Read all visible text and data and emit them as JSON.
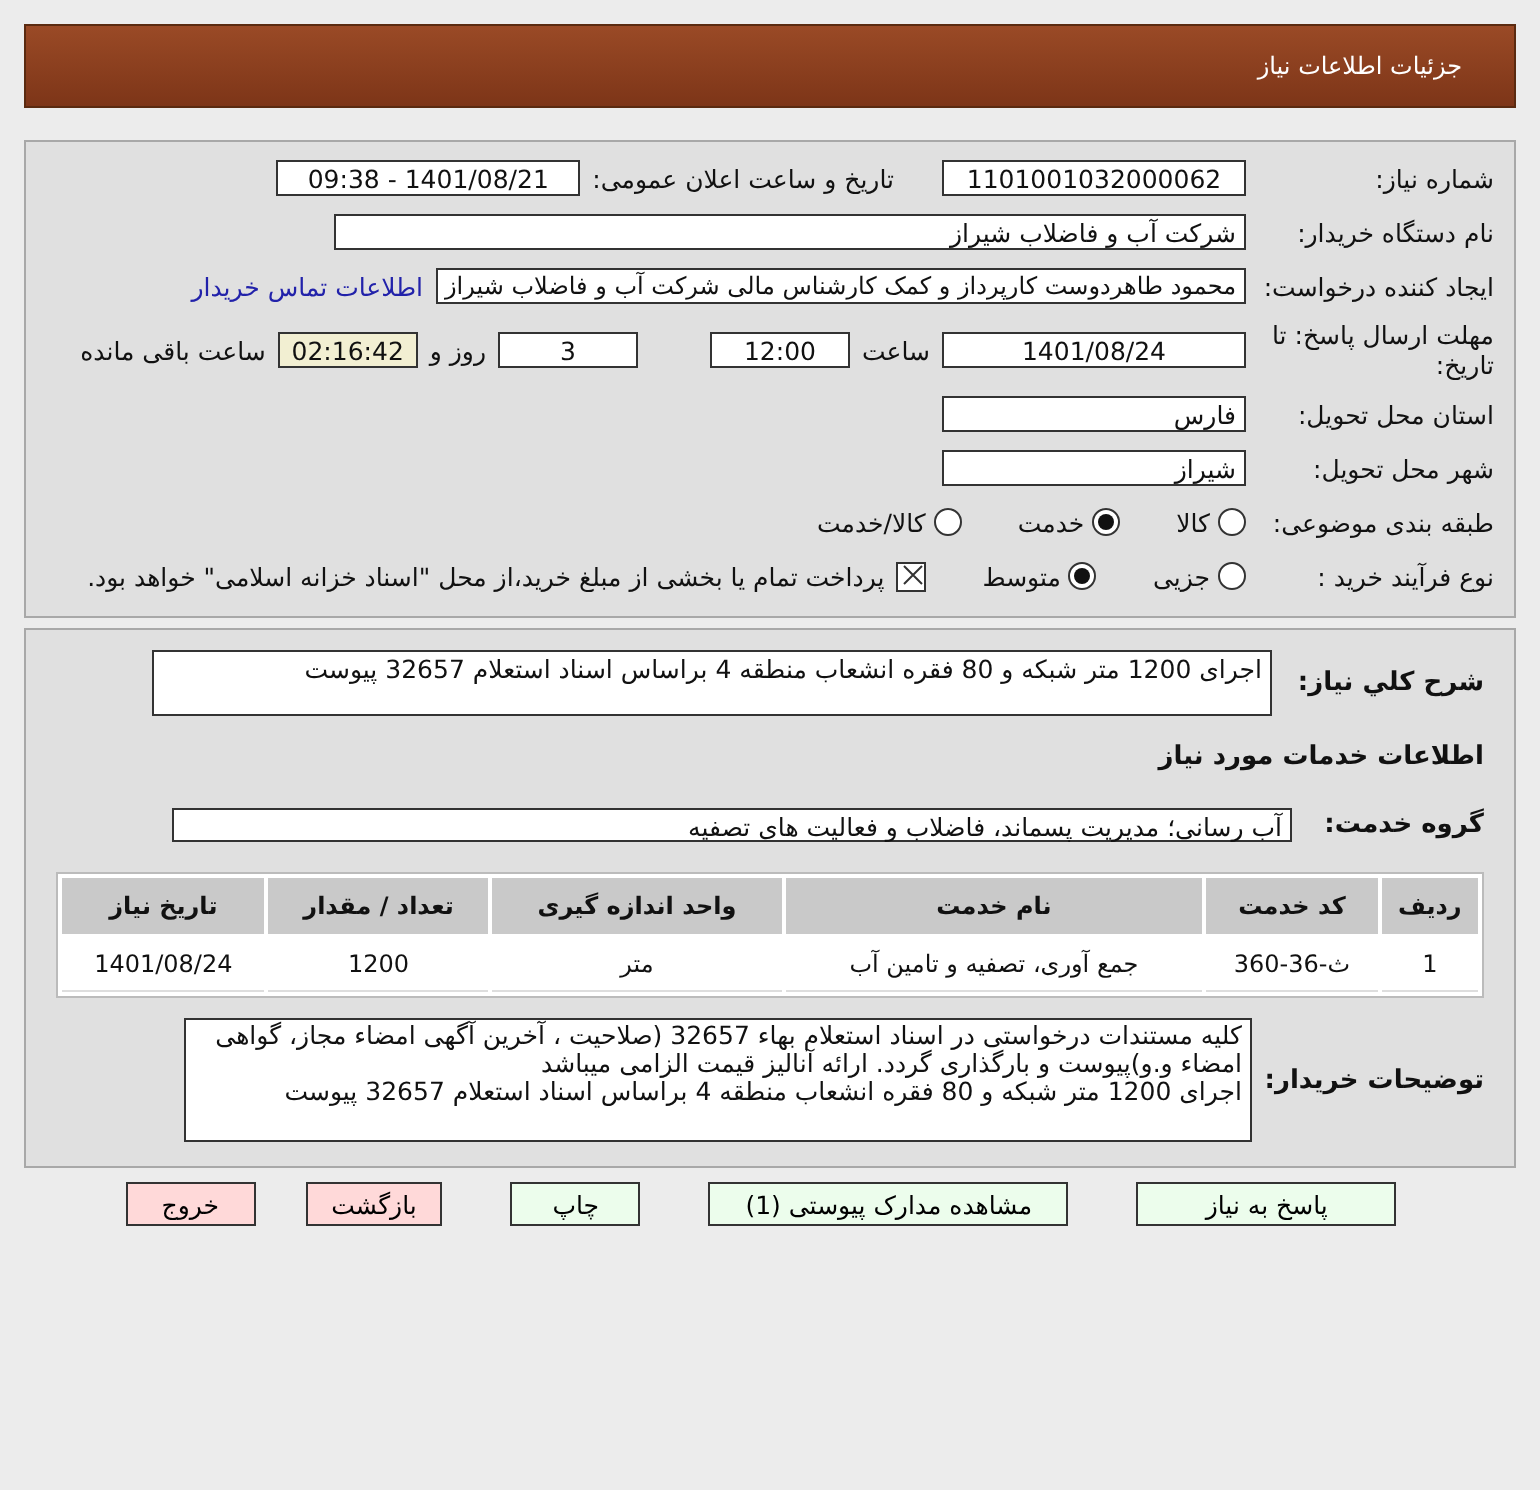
{
  "header": {
    "title": "جزئیات اطلاعات نیاز"
  },
  "details": {
    "need_number": {
      "label": "شماره نیاز:",
      "value": "1101001032000062"
    },
    "announce": {
      "label": "تاریخ و ساعت اعلان عمومی:",
      "value": "1401/08/21 - 09:38"
    },
    "buyer": {
      "label": "نام دستگاه خریدار:",
      "value": "شرکت آب و فاضلاب شیراز"
    },
    "creator": {
      "label": "ایجاد کننده درخواست:",
      "value": "محمود طاهردوست کارپرداز و کمک کارشناس مالی شرکت آب و فاضلاب شیراز",
      "link": "اطلاعات تماس خریدار"
    },
    "deadline": {
      "label": "مهلت ارسال پاسخ: تا تاریخ:",
      "date": "1401/08/24",
      "time_label": "ساعت",
      "time": "12:00",
      "days": "3",
      "days_label": "روز و",
      "remaining": "02:16:42",
      "remaining_label": "ساعت باقی مانده"
    },
    "province": {
      "label": "استان محل تحویل:",
      "value": "فارس"
    },
    "city": {
      "label": "شهر محل تحویل:",
      "value": "شیراز"
    },
    "category": {
      "label": "طبقه بندی موضوعی:",
      "options": [
        {
          "label": "کالا",
          "selected": false
        },
        {
          "label": "خدمت",
          "selected": true
        },
        {
          "label": "کالا/خدمت",
          "selected": false
        }
      ]
    },
    "process": {
      "label": "نوع فرآیند خرید :",
      "options": [
        {
          "label": "جزیی",
          "selected": false
        },
        {
          "label": "متوسط",
          "selected": true
        }
      ],
      "payment": {
        "checked": true,
        "text": "پرداخت تمام یا بخشی از مبلغ خرید،از محل \"اسناد خزانه اسلامی\" خواهد بود."
      }
    }
  },
  "services": {
    "summary": {
      "label": "شرح کلي نياز:",
      "value": "اجرای 1200 متر شبکه و 80 فقره انشعاب منطقه 4 براساس اسناد استعلام 32657 پیوست"
    },
    "heading": "اطلاعات خدمات مورد نیاز",
    "group": {
      "label": "گروه خدمت:",
      "value": "آب رسانی؛ مدیریت پسماند، فاضلاب و فعالیت های تصفیه"
    },
    "table": {
      "columns": [
        "ردیف",
        "کد خدمت",
        "نام خدمت",
        "واحد اندازه گیری",
        "تعداد / مقدار",
        "تاریخ نیاز"
      ],
      "rows": [
        [
          "1",
          "ث-36-360",
          "جمع آوری، تصفیه و تامین آب",
          "متر",
          "1200",
          "1401/08/24"
        ]
      ]
    },
    "notes": {
      "label": "توضیحات خریدار:",
      "value": "کلیه مستندات درخواستی در اسناد استعلام بهاء 32657  (صلاحیت ، آخرین آگهی امضاء مجاز، گواهی امضاء و.و)پیوست و بارگذاری گردد. ارائه آنالیز قیمت الزامی میباشد\nاجرای 1200 متر شبکه و 80 فقره انشعاب منطقه 4 براساس اسناد استعلام 32657 پیوست"
    }
  },
  "buttons": [
    {
      "label": "پاسخ به نیاز",
      "kind": "action"
    },
    {
      "label": "مشاهده مدارک پیوستی (1)",
      "kind": "action"
    },
    {
      "label": "چاپ",
      "kind": "action"
    },
    {
      "label": "بازگشت",
      "kind": "exit"
    },
    {
      "label": "خروج",
      "kind": "exit"
    }
  ]
}
